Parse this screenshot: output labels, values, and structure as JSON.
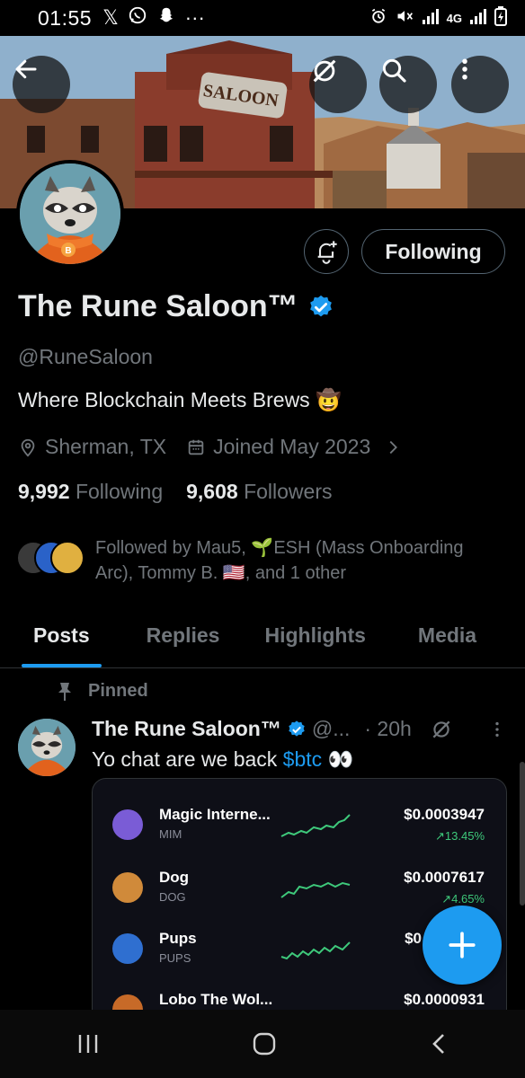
{
  "status_bar": {
    "time": "01:55",
    "network": "4G",
    "notification_icons": [
      "x-logo-icon",
      "whatsapp-icon",
      "snapchat-icon",
      "more-dots-icon"
    ],
    "system_icons": [
      "alarm-icon",
      "mute-icon",
      "signal-icon",
      "battery-icon"
    ]
  },
  "profile": {
    "display_name": "The Rune Saloon™",
    "handle": "@RuneSaloon",
    "bio_text": "Where Blockchain Meets Brews",
    "bio_emoji": "🤠",
    "location": "Sherman, TX",
    "joined": "Joined May 2023",
    "following_count": "9,992",
    "following_label": "Following",
    "followers_count": "9,608",
    "followers_label": "Followers",
    "followed_by_text": "Followed by Mau5, 🌱ESH (Mass Onboarding Arc), Tommy B. 🇺🇸, and 1 other",
    "banner_sign": "SALOON",
    "avatar_badge": "B"
  },
  "actions": {
    "following_button": "Following"
  },
  "tabs": [
    {
      "label": "Posts",
      "active": true
    },
    {
      "label": "Replies",
      "active": false
    },
    {
      "label": "Highlights",
      "active": false
    },
    {
      "label": "Media",
      "active": false
    }
  ],
  "pinned_post": {
    "pinned_label": "Pinned",
    "author": "The Rune Saloon™",
    "handle_trunc": "@...",
    "time": "· 20h",
    "text_before": "Yo chat are we back ",
    "cashtag": "$btc",
    "text_after": " 👀",
    "embed_assets": [
      {
        "name": "Magic Interne...",
        "ticker": "MIM",
        "price": "$0.0003947",
        "change": "↗13.45%",
        "icon_color": "#7a5cd6"
      },
      {
        "name": "Dog",
        "ticker": "DOG",
        "price": "$0.0007617",
        "change": "↗4.65%",
        "icon_color": "#d08a3a"
      },
      {
        "name": "Pups",
        "ticker": "PUPS",
        "price": "$0",
        "change": "",
        "icon_color": "#2f6fd0"
      },
      {
        "name": "Lobo The Wol...",
        "ticker": "",
        "price": "$0.0000931",
        "change": "",
        "icon_color": "#c76a28"
      }
    ]
  },
  "colors": {
    "accent": "#1d9bf0",
    "muted_text": "#71767b",
    "positive": "#3ec97b",
    "background": "#000000"
  }
}
